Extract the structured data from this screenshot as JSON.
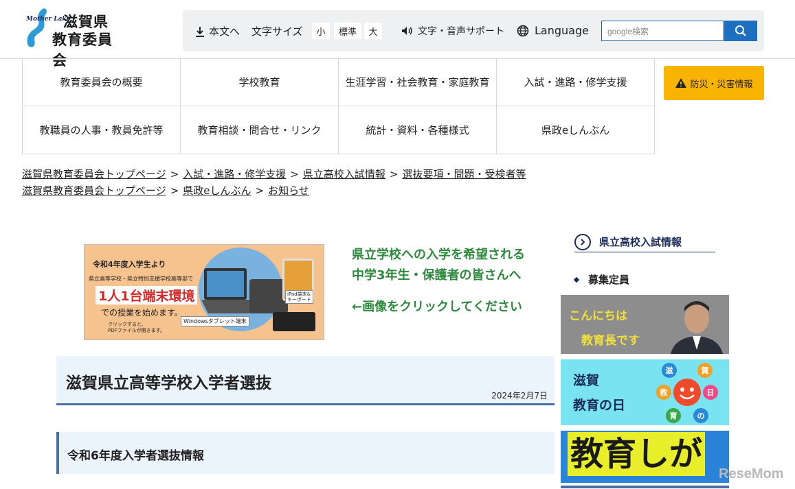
{
  "logo": {
    "mother_lake": "Mother Lake",
    "line1": "滋賀県",
    "line2": "教育委員会"
  },
  "toolbar": {
    "honbun": "本文へ",
    "font_size_label": "文字サイズ",
    "font_small": "小",
    "font_standard": "標準",
    "font_large": "大",
    "voice_support": "文字・音声サポート",
    "language": "Language",
    "search_placeholder": "google検索"
  },
  "nav": [
    "教育委員会の概要",
    "学校教育",
    "生涯学習・社会教育・家庭教育",
    "入試・進路・修学支援",
    "教職員の人事・教員免許等",
    "教育相談・問合せ・リンク",
    "統計・資料・各種様式",
    "県政eしんぶん"
  ],
  "disaster_label": "防災・災害情報",
  "breadcrumb1": [
    "滋賀県教育委員会トップページ",
    "入試・進路・修学支援",
    "県立高校入試情報",
    "選抜要項・問題・受検者等"
  ],
  "breadcrumb2": [
    "滋賀県教育委員会トップページ",
    "県政eしんぶん",
    "お知らせ"
  ],
  "banner": {
    "line1": "令和4年度入学生より",
    "line2": "県立高等学校・県立特別支援学校高等部で",
    "line3": "1人1台端末環境",
    "line4": "での授業を始めます。",
    "line5a": "クリックすると、",
    "line5b": "PDFファイルが開きます。",
    "tablet_label": "Windowsタブレット端末",
    "ipad_label_a": "iPad端末&",
    "ipad_label_b": "キーボード"
  },
  "promo": {
    "line1": "県立学校への入学を希望される",
    "line2": "中学3年生・保護者の皆さんへ",
    "line3": "←画像をクリックしてください"
  },
  "page_title": "滋賀県立高等学校入学者選抜",
  "page_date": "2024年2月7日",
  "section_title": "令和6年度入学者選抜情報",
  "sidebar": {
    "heading": "県立高校入試情報",
    "item1": "募集定員",
    "hello1": "こんにちは",
    "hello2": "教育長です",
    "day1": "滋賀",
    "day2": "教育の日",
    "sun_chars": [
      "滋",
      "賀",
      "教",
      "育",
      "の",
      "日"
    ],
    "edu": "教育しが"
  },
  "watermark": "ReseMom",
  "colors": {
    "accent_blue": "#1d6fc2",
    "disaster_yellow": "#f8b400",
    "promo_green": "#2d8a3d",
    "title_bg": "#ebf3fc",
    "title_border": "#4a6fa5"
  }
}
